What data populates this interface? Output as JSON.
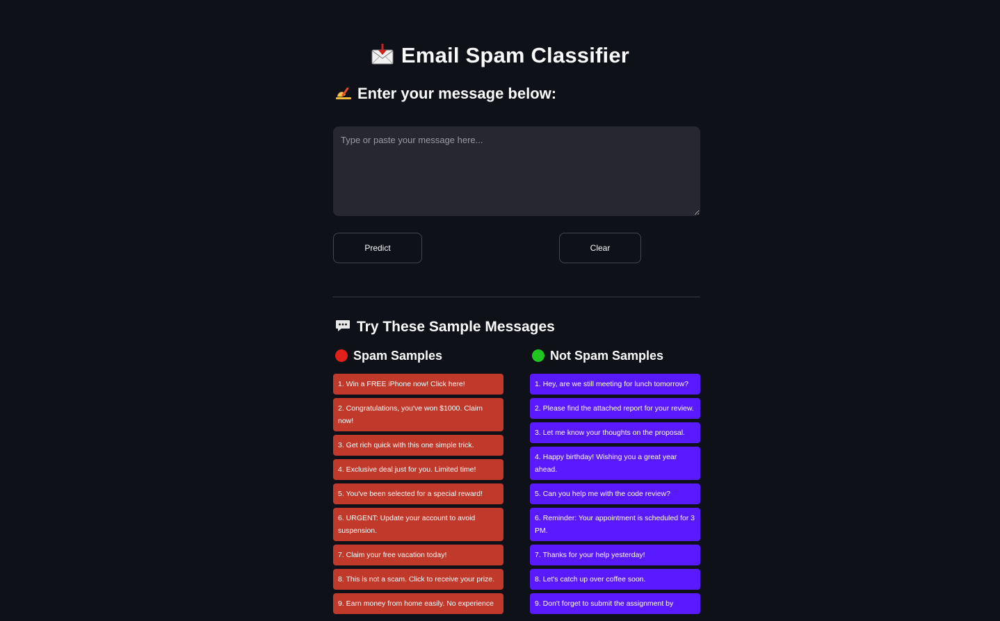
{
  "header": {
    "title": "Email Spam Classifier",
    "title_icon": "envelope-with-arrow-icon",
    "subtitle": "Enter your message below:",
    "subtitle_icon": "writing-hand-icon"
  },
  "input": {
    "value": "",
    "placeholder": "Type or paste your message here..."
  },
  "buttons": {
    "predict_label": "Predict",
    "clear_label": "Clear"
  },
  "samples": {
    "section_title": "Try These Sample Messages",
    "section_icon": "speech-balloon-icon",
    "spam": {
      "heading": "Spam Samples",
      "dot_color": "#e0201b",
      "button_color": "#c0392b",
      "items": [
        "1. Win a FREE iPhone now! Click here!",
        "2. Congratulations, you've won $1000. Claim now!",
        "3. Get rich quick with this one simple trick.",
        "4. Exclusive deal just for you. Limited time!",
        "5. You've been selected for a special reward!",
        "6. URGENT: Update your account to avoid suspension.",
        "7. Claim your free vacation today!",
        "8. This is not a scam. Click to receive your prize.",
        "9. Earn money from home easily. No experience"
      ]
    },
    "not_spam": {
      "heading": "Not Spam Samples",
      "dot_color": "#1fc61f",
      "button_color": "#5a1aff",
      "items": [
        "1. Hey, are we still meeting for lunch tomorrow?",
        "2. Please find the attached report for your review.",
        "3. Let me know your thoughts on the proposal.",
        "4. Happy birthday! Wishing you a great year ahead.",
        "5. Can you help me with the code review?",
        "6. Reminder: Your appointment is scheduled for 3 PM.",
        "7. Thanks for your help yesterday!",
        "8. Let's catch up over coffee soon.",
        "9. Don't forget to submit the assignment by"
      ]
    }
  }
}
